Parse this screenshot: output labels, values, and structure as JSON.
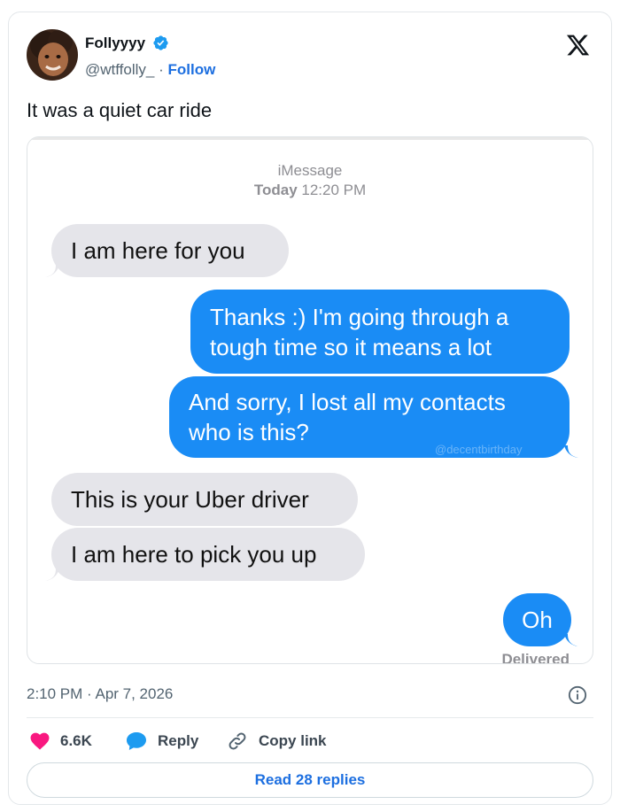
{
  "author": {
    "name": "Follyyyy",
    "handle": "@wtffolly_",
    "separator": "·",
    "follow_label": "Follow",
    "verified": true
  },
  "tweet_text": "It was a quiet car ride",
  "media": {
    "service_label": "iMessage",
    "date_bold": "Today",
    "time": "12:20 PM",
    "messages": [
      {
        "direction": "incoming",
        "text": "I am here for you"
      },
      {
        "direction": "outgoing",
        "text": "Thanks :) I'm going through a tough time so it means a lot"
      },
      {
        "direction": "outgoing",
        "text": "And sorry, I lost all my contacts who is this?"
      },
      {
        "direction": "incoming",
        "text": "This is your Uber driver"
      },
      {
        "direction": "incoming",
        "text": "I am here to pick you up"
      },
      {
        "direction": "outgoing",
        "text": "Oh"
      }
    ],
    "watermark": "@decentbirthday",
    "status": "Delivered"
  },
  "timestamp": "2:10 PM · Apr 7, 2026",
  "actions": {
    "likes": "6.6K",
    "reply_label": "Reply",
    "copy_label": "Copy link"
  },
  "read_replies_label": "Read 28 replies",
  "colors": {
    "accent": "#1d6fe0",
    "like": "#f91880",
    "outgoing_bubble": "#1a8cf5",
    "incoming_bubble": "#e5e5ea"
  },
  "icons": [
    "avatar",
    "verified-badge-icon",
    "x-logo-icon",
    "info-icon",
    "heart-icon",
    "reply-bubble-icon",
    "link-icon"
  ]
}
